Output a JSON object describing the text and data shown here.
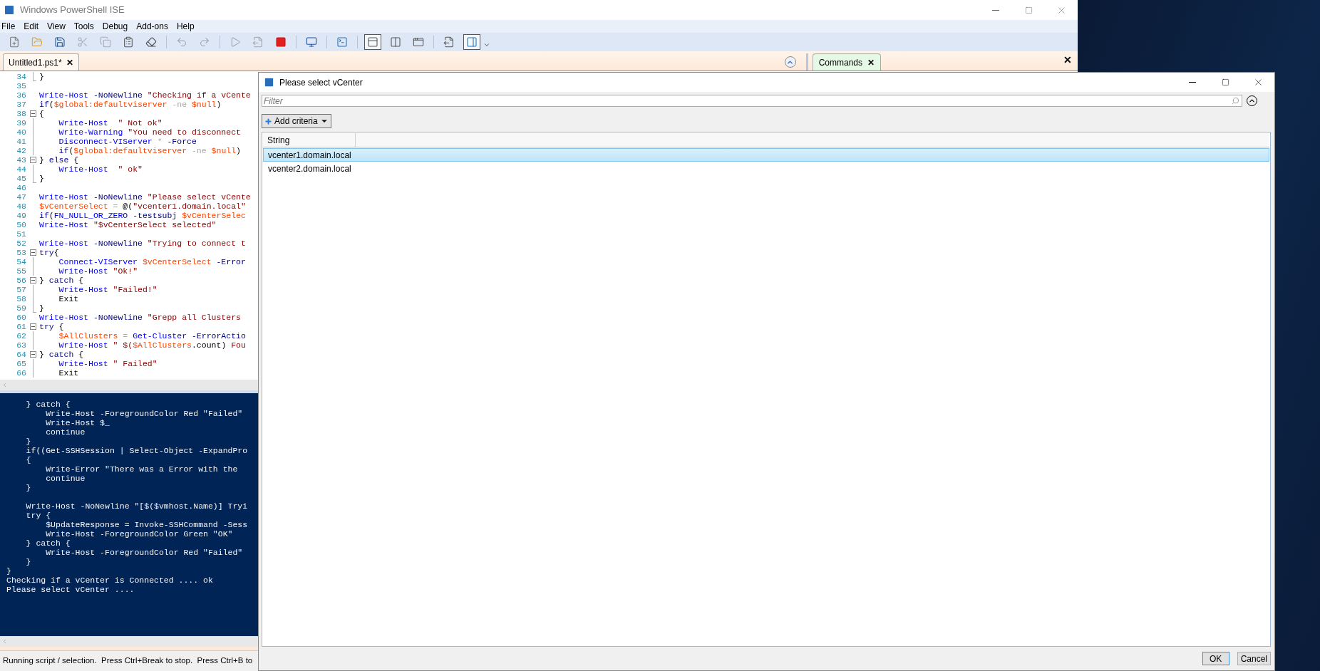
{
  "window": {
    "title": "Windows PowerShell ISE"
  },
  "menu": [
    "File",
    "Edit",
    "View",
    "Tools",
    "Debug",
    "Add-ons",
    "Help"
  ],
  "toolbar": [
    {
      "kind": "new",
      "disabled": false,
      "pressed": false
    },
    {
      "kind": "open",
      "disabled": false,
      "pressed": false
    },
    {
      "kind": "save",
      "disabled": false,
      "pressed": false
    },
    {
      "kind": "cut",
      "disabled": true,
      "pressed": false
    },
    {
      "kind": "copy",
      "disabled": true,
      "pressed": false
    },
    {
      "kind": "paste",
      "disabled": false,
      "pressed": false
    },
    {
      "kind": "clear",
      "disabled": false,
      "pressed": false
    },
    {
      "kind": "undo",
      "disabled": true,
      "pressed": false
    },
    {
      "kind": "redo",
      "disabled": true,
      "pressed": false
    },
    {
      "kind": "run",
      "disabled": true,
      "pressed": false
    },
    {
      "kind": "run-selection",
      "disabled": true,
      "pressed": false
    },
    {
      "kind": "stop",
      "disabled": false,
      "pressed": false
    },
    {
      "kind": "remote",
      "disabled": false,
      "pressed": false
    },
    {
      "kind": "console",
      "disabled": false,
      "pressed": false
    },
    {
      "kind": "layout-top",
      "disabled": false,
      "pressed": true
    },
    {
      "kind": "layout-right",
      "disabled": false,
      "pressed": false
    },
    {
      "kind": "layout-max",
      "disabled": false,
      "pressed": false
    },
    {
      "kind": "script-pane",
      "disabled": false,
      "pressed": false
    },
    {
      "kind": "commands-pane",
      "disabled": false,
      "pressed": true
    }
  ],
  "script_tab": {
    "label": "Untitled1.ps1*",
    "close": "✕"
  },
  "commands_tab": {
    "label": "Commands",
    "close": "✕"
  },
  "pane_close": "✕",
  "editor": {
    "lines": [
      {
        "number": "34",
        "kind": "closer",
        "tokens": [
          {
            "kind": "plain",
            "text": "}"
          }
        ]
      },
      {
        "number": "35",
        "kind": "plain"
      },
      {
        "number": "36",
        "kind": "plain",
        "tokens": [
          {
            "kind": "cmd",
            "text": "Write-Host"
          },
          {
            "kind": "param",
            "text": " -NoNewline"
          },
          {
            "kind": "string",
            "text": " \"Checking if a vCente"
          }
        ]
      },
      {
        "number": "37",
        "kind": "plain",
        "tokens": [
          {
            "kind": "keyword",
            "text": "if"
          },
          {
            "kind": "plain",
            "text": "("
          },
          {
            "kind": "variable",
            "text": "$global:defaultviserver"
          },
          {
            "kind": "operator",
            "text": " -ne "
          },
          {
            "kind": "variable",
            "text": "$null"
          },
          {
            "kind": "plain",
            "text": ")"
          }
        ]
      },
      {
        "number": "38",
        "kind": "opener",
        "tokens": [
          {
            "kind": "plain",
            "text": "{"
          }
        ]
      },
      {
        "number": "39",
        "kind": "inner",
        "tokens": [
          {
            "kind": "cmd",
            "text": "    Write-Host"
          },
          {
            "kind": "string",
            "text": "  \" Not ok\""
          }
        ]
      },
      {
        "number": "40",
        "kind": "inner",
        "tokens": [
          {
            "kind": "cmd",
            "text": "    Write-Warning"
          },
          {
            "kind": "string",
            "text": " \"You need to disconnect"
          }
        ]
      },
      {
        "number": "41",
        "kind": "inner",
        "tokens": [
          {
            "kind": "cmd",
            "text": "    Disconnect-VIServer"
          },
          {
            "kind": "operator",
            "text": " *"
          },
          {
            "kind": "param",
            "text": " -Force"
          }
        ]
      },
      {
        "number": "42",
        "kind": "inner",
        "tokens": [
          {
            "kind": "keyword",
            "text": "    if"
          },
          {
            "kind": "plain",
            "text": "("
          },
          {
            "kind": "variable",
            "text": "$global:defaultviserver"
          },
          {
            "kind": "operator",
            "text": " -ne "
          },
          {
            "kind": "variable",
            "text": "$null"
          },
          {
            "kind": "plain",
            "text": ")"
          }
        ]
      },
      {
        "number": "43",
        "kind": "opener",
        "tokens": [
          {
            "kind": "plain",
            "text": "} "
          },
          {
            "kind": "keyword",
            "text": "else"
          },
          {
            "kind": "plain",
            "text": " {"
          }
        ]
      },
      {
        "number": "44",
        "kind": "inner",
        "tokens": [
          {
            "kind": "cmd",
            "text": "    Write-Host"
          },
          {
            "kind": "string",
            "text": "  \" ok\""
          }
        ]
      },
      {
        "number": "45",
        "kind": "closer",
        "tokens": [
          {
            "kind": "plain",
            "text": "}"
          }
        ]
      },
      {
        "number": "46",
        "kind": "plain"
      },
      {
        "number": "47",
        "kind": "plain",
        "tokens": [
          {
            "kind": "cmd",
            "text": "Write-Host"
          },
          {
            "kind": "param",
            "text": " -NoNewline"
          },
          {
            "kind": "string",
            "text": " \"Please select vCente"
          }
        ]
      },
      {
        "number": "48",
        "kind": "plain",
        "tokens": [
          {
            "kind": "variable",
            "text": "$vCenterSelect"
          },
          {
            "kind": "operator",
            "text": " = "
          },
          {
            "kind": "plain",
            "text": "@("
          },
          {
            "kind": "string",
            "text": "\"vcenter1.domain.local\""
          }
        ]
      },
      {
        "number": "49",
        "kind": "plain",
        "tokens": [
          {
            "kind": "keyword",
            "text": "if"
          },
          {
            "kind": "plain",
            "text": "("
          },
          {
            "kind": "cmd",
            "text": "FN_NULL_OR_ZERO"
          },
          {
            "kind": "param",
            "text": " -testsubj"
          },
          {
            "kind": "variable",
            "text": " $vCenterSelec"
          }
        ]
      },
      {
        "number": "50",
        "kind": "plain",
        "tokens": [
          {
            "kind": "cmd",
            "text": "Write-Host"
          },
          {
            "kind": "string",
            "text": " \"$vCenterSelect selected\""
          }
        ]
      },
      {
        "number": "51",
        "kind": "plain"
      },
      {
        "number": "52",
        "kind": "plain",
        "tokens": [
          {
            "kind": "cmd",
            "text": "Write-Host"
          },
          {
            "kind": "param",
            "text": " -NoNewline"
          },
          {
            "kind": "string",
            "text": " \"Trying to connect t"
          }
        ]
      },
      {
        "number": "53",
        "kind": "opener",
        "tokens": [
          {
            "kind": "keyword",
            "text": "try"
          },
          {
            "kind": "plain",
            "text": "{"
          }
        ]
      },
      {
        "number": "54",
        "kind": "inner",
        "tokens": [
          {
            "kind": "cmd",
            "text": "    Connect-VIServer"
          },
          {
            "kind": "variable",
            "text": " $vCenterSelect"
          },
          {
            "kind": "param",
            "text": " -Error"
          }
        ]
      },
      {
        "number": "55",
        "kind": "inner",
        "tokens": [
          {
            "kind": "cmd",
            "text": "    Write-Host"
          },
          {
            "kind": "string",
            "text": " \"Ok!\""
          }
        ]
      },
      {
        "number": "56",
        "kind": "opener",
        "tokens": [
          {
            "kind": "plain",
            "text": "} "
          },
          {
            "kind": "keyword",
            "text": "catch"
          },
          {
            "kind": "plain",
            "text": " {"
          }
        ]
      },
      {
        "number": "57",
        "kind": "inner",
        "tokens": [
          {
            "kind": "cmd",
            "text": "    Write-Host"
          },
          {
            "kind": "string",
            "text": " \"Failed!\""
          }
        ]
      },
      {
        "number": "58",
        "kind": "inner",
        "tokens": [
          {
            "kind": "plain",
            "text": "    Exit"
          }
        ]
      },
      {
        "number": "59",
        "kind": "closer",
        "tokens": [
          {
            "kind": "plain",
            "text": "}"
          }
        ]
      },
      {
        "number": "60",
        "kind": "plain",
        "tokens": [
          {
            "kind": "cmd",
            "text": "Write-Host"
          },
          {
            "kind": "param",
            "text": " -NoNewline"
          },
          {
            "kind": "string",
            "text": " \"Grepp all Clusters"
          }
        ]
      },
      {
        "number": "61",
        "kind": "opener",
        "tokens": [
          {
            "kind": "keyword",
            "text": "try"
          },
          {
            "kind": "plain",
            "text": " {"
          }
        ]
      },
      {
        "number": "62",
        "kind": "inner",
        "tokens": [
          {
            "kind": "variable",
            "text": "    $AllClusters"
          },
          {
            "kind": "operator",
            "text": " = "
          },
          {
            "kind": "cmd",
            "text": "Get-Cluster"
          },
          {
            "kind": "param",
            "text": " -ErrorActio"
          }
        ]
      },
      {
        "number": "63",
        "kind": "inner",
        "tokens": [
          {
            "kind": "cmd",
            "text": "    Write-Host"
          },
          {
            "kind": "string",
            "text": " \" $("
          },
          {
            "kind": "variable",
            "text": "$AllClusters"
          },
          {
            "kind": "plain",
            "text": ".count)"
          },
          {
            "kind": "string",
            "text": " Fou"
          }
        ]
      },
      {
        "number": "64",
        "kind": "opener",
        "tokens": [
          {
            "kind": "plain",
            "text": "} "
          },
          {
            "kind": "keyword",
            "text": "catch"
          },
          {
            "kind": "plain",
            "text": " {"
          }
        ]
      },
      {
        "number": "65",
        "kind": "inner",
        "tokens": [
          {
            "kind": "cmd",
            "text": "    Write-Host"
          },
          {
            "kind": "string",
            "text": " \" Failed\""
          }
        ]
      },
      {
        "number": "66",
        "kind": "inner",
        "tokens": [
          {
            "kind": "plain",
            "text": "    Exit"
          }
        ]
      }
    ]
  },
  "console": {
    "blocks": [
      [
        "    } catch {",
        "        Write-Host -ForegroundColor Red \"Failed\"",
        "        Write-Host $_",
        "        continue",
        "    }",
        "    if((Get-SSHSession | Select-Object -ExpandPro",
        "    {",
        "        Write-Error \"There was a Error with the",
        "        continue",
        "    }"
      ],
      [
        "    Write-Host -NoNewline \"[$($vmhost.Name)] Tryi",
        "    try {",
        "        $UpdateResponse = Invoke-SSHCommand -Sess",
        "        Write-Host -ForegroundColor Green \"OK\"",
        "    } catch {",
        "        Write-Host -ForegroundColor Red \"Failed\"",
        "    }",
        "}",
        "Checking if a vCenter is Connected .... ok",
        "Please select vCenter ...."
      ]
    ]
  },
  "status_bar": "Running script / selection.  Press Ctrl+Break to stop.  Press Ctrl+B to",
  "dialog": {
    "title": "Please select vCenter",
    "filter": {
      "placeholder": "Filter"
    },
    "add_criteria": "Add criteria",
    "columns": [
      "String"
    ],
    "rows": [
      {
        "cells": [
          "vcenter1.domain.local"
        ],
        "selected": true
      },
      {
        "cells": [
          "vcenter2.domain.local"
        ],
        "selected": false
      }
    ],
    "buttons": [
      "OK",
      "Cancel"
    ]
  }
}
